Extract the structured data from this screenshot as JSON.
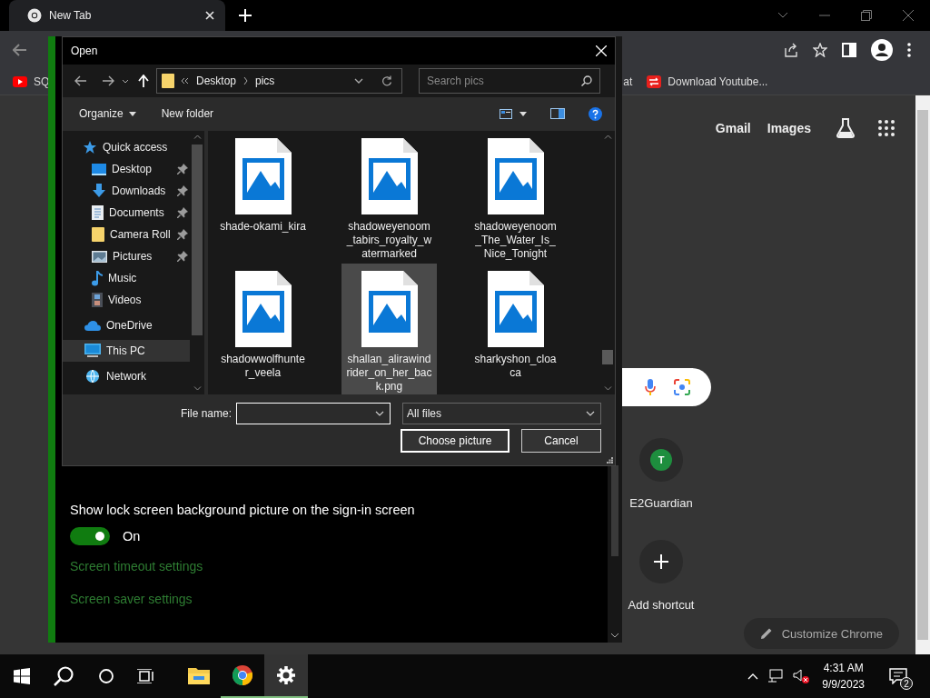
{
  "browser": {
    "tab": {
      "title": "New Tab"
    },
    "bookmarks": [
      {
        "label": "SQ",
        "kind": "youtube"
      },
      {
        "label": "at",
        "kind": "none"
      },
      {
        "label": "Download Youtube...",
        "kind": "redarrows"
      }
    ],
    "header_links": [
      "Gmail",
      "Images"
    ],
    "shortcuts": [
      {
        "kind": "site",
        "initial": "T",
        "label": "E2Guardian"
      },
      {
        "kind": "add",
        "label": "Add shortcut"
      }
    ],
    "customize_button": "Customize Chrome"
  },
  "settings": {
    "option_label": "Show lock screen background picture on the sign-in screen",
    "toggle": {
      "on": true,
      "label": "On"
    },
    "links": [
      "Screen timeout settings",
      "Screen saver settings"
    ]
  },
  "dialog": {
    "title": "Open",
    "breadcrumb": [
      "Desktop",
      "pics"
    ],
    "search": {
      "placeholder": "Search pics"
    },
    "toolbar": [
      "Organize",
      "New folder"
    ],
    "nav": [
      {
        "label": "Quick access",
        "kind": "star",
        "selected": false,
        "children": [
          {
            "label": "Desktop",
            "kind": "desktop",
            "pinned": true,
            "selected": false
          },
          {
            "label": "Downloads",
            "kind": "download",
            "pinned": true,
            "selected": false
          },
          {
            "label": "Documents",
            "kind": "document",
            "pinned": true,
            "selected": false
          },
          {
            "label": "Camera Roll",
            "kind": "folder",
            "pinned": true,
            "selected": false
          },
          {
            "label": "Pictures",
            "kind": "pictures",
            "pinned": true,
            "selected": false
          },
          {
            "label": "Music",
            "kind": "music",
            "pinned": false,
            "selected": false
          },
          {
            "label": "Videos",
            "kind": "videos",
            "pinned": false,
            "selected": false
          }
        ]
      },
      {
        "label": "OneDrive",
        "kind": "cloud",
        "selected": false
      },
      {
        "label": "This PC",
        "kind": "pc",
        "selected": true
      },
      {
        "label": "Network",
        "kind": "network",
        "selected": false
      }
    ],
    "files": [
      {
        "name": "shade-okami_kira",
        "selected": false
      },
      {
        "name": "shadoweyenoom_tabirs_royalty_watermarked",
        "selected": false
      },
      {
        "name": "shadoweyenoom_The_Water_Is_Nice_Tonight",
        "selected": false
      },
      {
        "name": "shadowwolfhunter_veela",
        "selected": false
      },
      {
        "name": "shallan_alirawindrider_on_her_back.png",
        "selected": true
      },
      {
        "name": "sharkyshon_cloaca",
        "selected": false
      }
    ],
    "file_name_label": "File name:",
    "file_type": "All files",
    "buttons": [
      "Choose picture",
      "Cancel"
    ]
  },
  "taskbar": {
    "apps": [
      {
        "kind": "explorer",
        "running": false,
        "selected": false
      },
      {
        "kind": "chrome",
        "running": true,
        "selected": false
      },
      {
        "kind": "settings",
        "running": true,
        "selected": true
      }
    ],
    "time": "4:31 AM",
    "date": "9/9/2023",
    "notifications": "2"
  }
}
